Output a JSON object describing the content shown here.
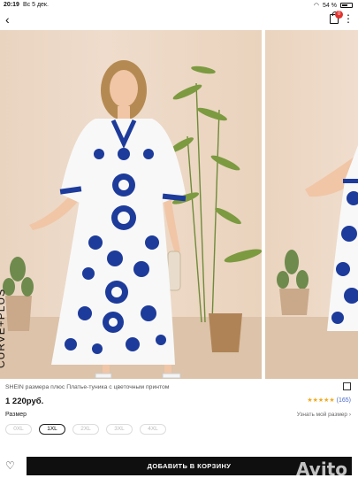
{
  "status": {
    "time": "20:19",
    "date": "Вс 5 дек.",
    "battery": "54 %"
  },
  "nav": {
    "back": "‹",
    "cart_count": "0"
  },
  "gallery": {
    "vertical_label": "CURVE+PLUS",
    "colors": {
      "dress_blue": "#1d3b9a",
      "dress_white": "#f8f8f8",
      "plant": "#6f8b3a"
    }
  },
  "product": {
    "title": "SHEIN размера плюс Платье-туника с цветочным принтом",
    "price": "1 220руб.",
    "rating": "★★★★★",
    "reviews": "(165)",
    "size_label": "Размер",
    "size_link": "Узнать мой размер ›",
    "sizes": [
      "0XL",
      "1XL",
      "2XL",
      "3XL",
      "4XL"
    ],
    "selected_size": "1XL"
  },
  "bottom": {
    "add_button": "ДОБАВИТЬ В КОРЗИНУ",
    "watermark": "Avito"
  }
}
